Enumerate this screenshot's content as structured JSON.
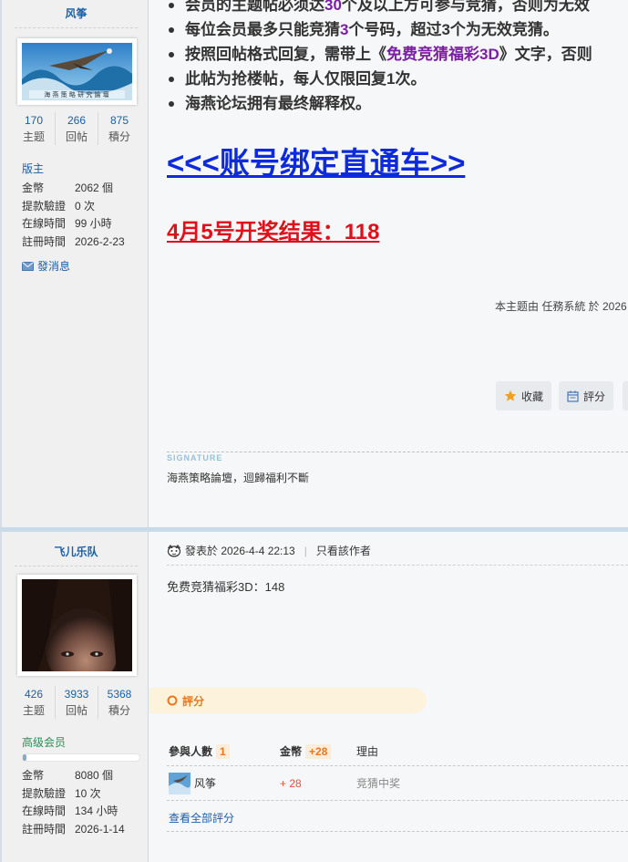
{
  "post1": {
    "author": {
      "name": "风筝",
      "stats": [
        {
          "value": "170",
          "label": "主题"
        },
        {
          "value": "266",
          "label": "回帖"
        },
        {
          "value": "875",
          "label": "積分"
        }
      ],
      "group": "版主",
      "info": [
        {
          "k": "金幣",
          "v": "2062 個"
        },
        {
          "k": "提款驗證",
          "v": "0 次"
        },
        {
          "k": "在線時間",
          "v": "99 小時"
        },
        {
          "k": "註冊時間",
          "v": "2026-2-23"
        }
      ],
      "pm_label": "發消息"
    },
    "bullets": {
      "b1_pre": "会员的主题帖必须达",
      "b1_num": "30",
      "b1_post": "个及以上方可参与竞猜，否则为无效",
      "b2_pre": "每位会员最多只能竞猜",
      "b2_num": "3",
      "b2_post": "个号码，超过3个为无效竞猜。",
      "b3_pre": "按照回帖格式回复，需带上《",
      "b3_hl": "免费竞猜福彩3D",
      "b3_post": "》文字，否则",
      "b4": "此帖为抢楼帖，每人仅限回复1次。",
      "b5": "海燕论坛拥有最终解释权。"
    },
    "binding_link": "<<<账号绑定直通车>>",
    "result": "4月5号开奖结果：118",
    "meta": "本主题由 任務系統 於 2026",
    "actions": {
      "favorite": "收藏",
      "rate": "評分"
    },
    "signature_label": "SIGNATURE",
    "signature": "海燕策略論壇，迴歸福利不斷"
  },
  "post2": {
    "author": {
      "name": "飞儿乐队",
      "stats": [
        {
          "value": "426",
          "label": "主题"
        },
        {
          "value": "3933",
          "label": "回帖"
        },
        {
          "value": "5368",
          "label": "積分"
        }
      ],
      "group": "高级会员",
      "progress": 0.03,
      "info": [
        {
          "k": "金幣",
          "v": "8080 個"
        },
        {
          "k": "提款驗證",
          "v": "10 次"
        },
        {
          "k": "在線時間",
          "v": "134 小時"
        },
        {
          "k": "註冊時間",
          "v": "2026-1-14"
        }
      ]
    },
    "posted": "發表於 2026-4-4 22:13",
    "only_author": "只看該作者",
    "content": "免费竞猜福彩3D：148",
    "rate_label": "評分",
    "rating": {
      "h_people": "參與人數",
      "people_count": "1",
      "h_coins": "金幣",
      "coins_total": "+28",
      "h_reason": "理由",
      "rows": [
        {
          "user": "风筝",
          "coins": "+ 28",
          "reason": "竞猜中奖"
        }
      ],
      "view_all": "查看全部評分"
    }
  },
  "colors": {
    "accent": "#1a5fa8",
    "red": "#e0101a",
    "link_blue": "#0d2bdc",
    "orange": "#e87722"
  }
}
